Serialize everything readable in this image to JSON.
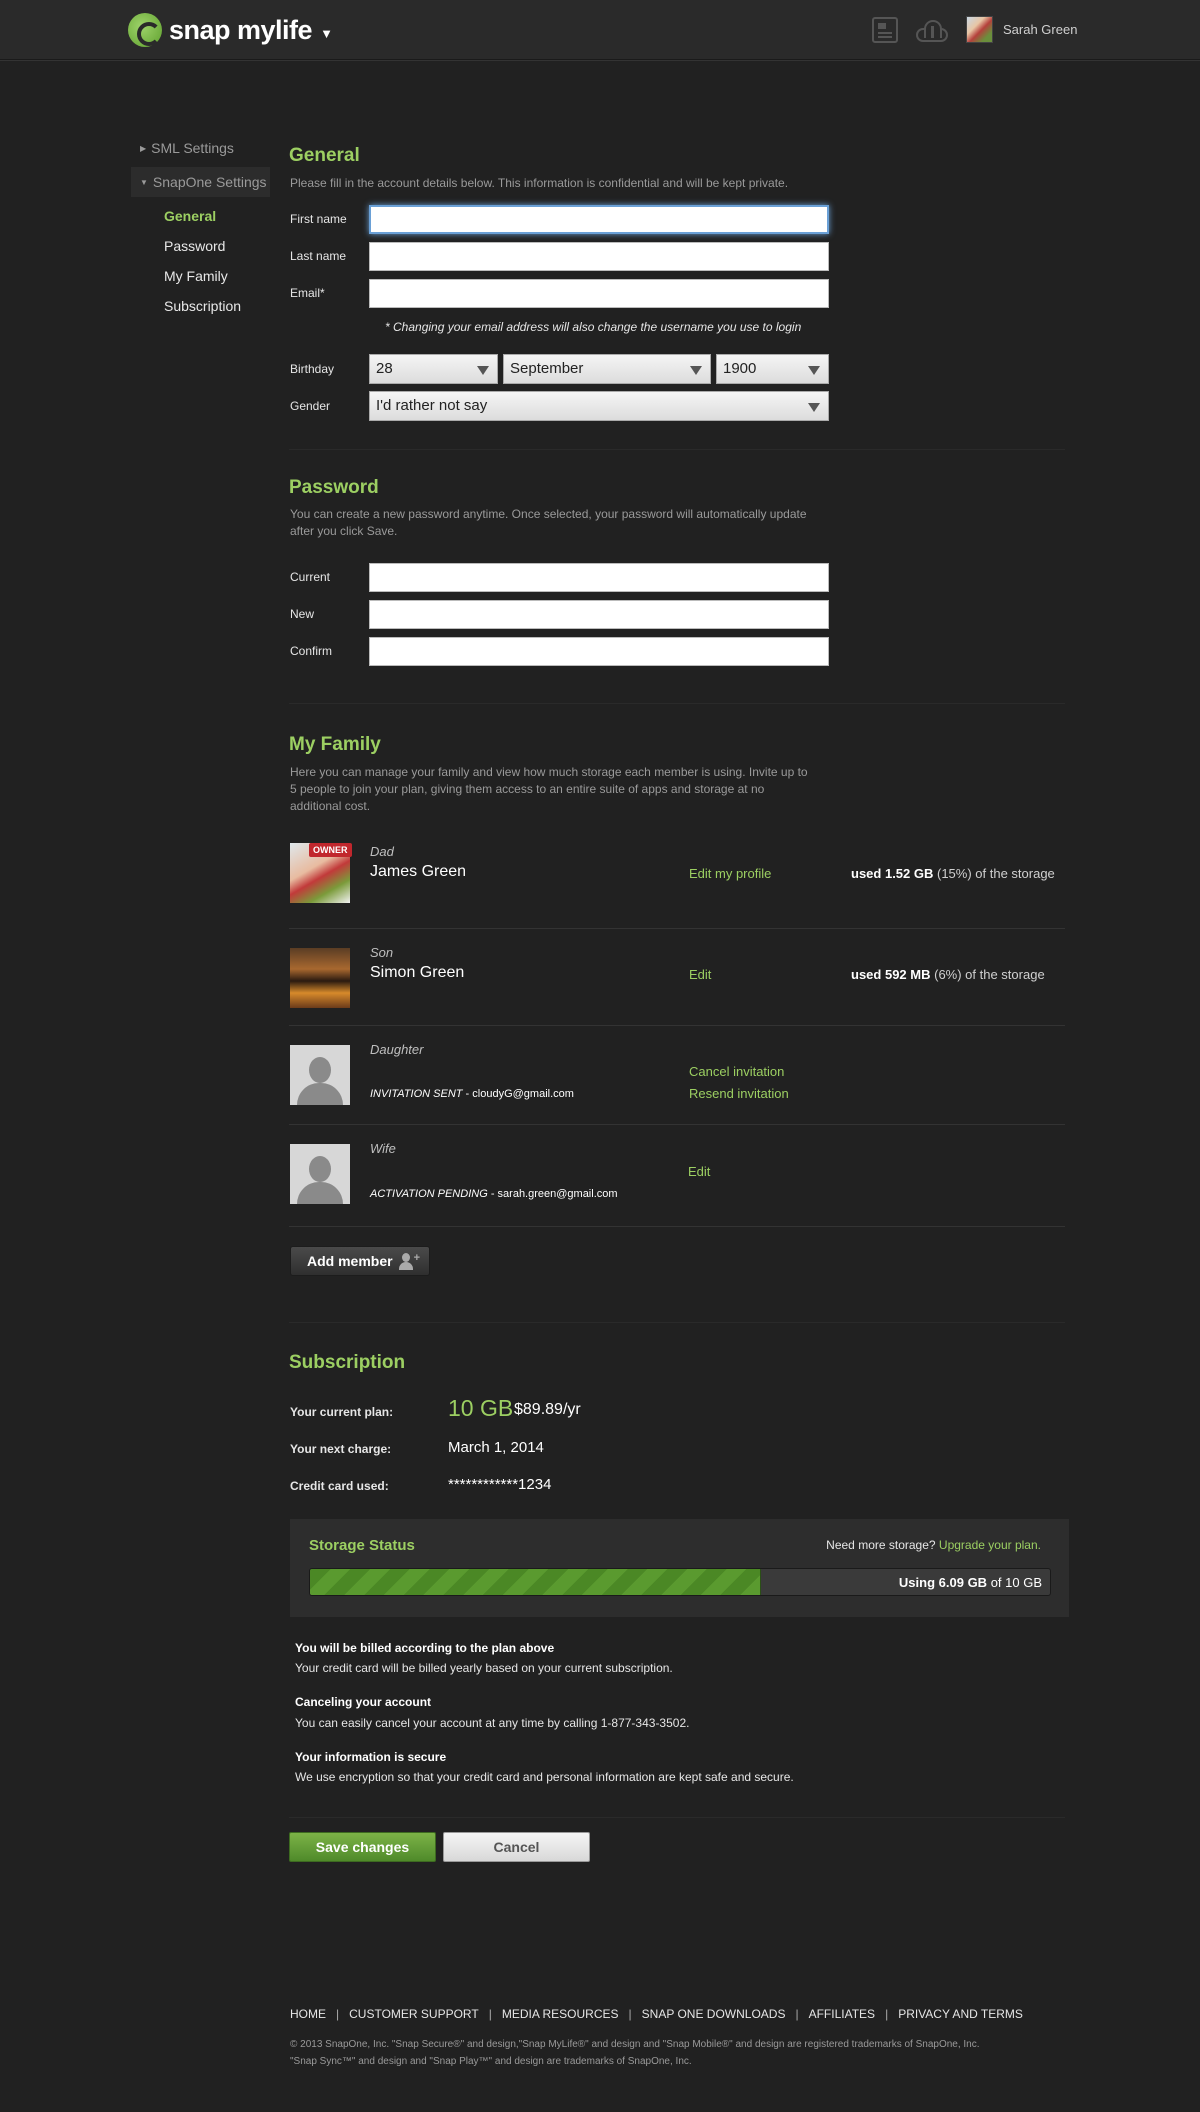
{
  "header": {
    "logo_text": "snap mylife",
    "user_name": "Sarah Green"
  },
  "sidebar": {
    "groups": [
      {
        "label": "SML Settings"
      },
      {
        "label": "SnapOne Settings"
      }
    ],
    "items": [
      {
        "label": "General"
      },
      {
        "label": "Password"
      },
      {
        "label": "My Family"
      },
      {
        "label": "Subscription"
      }
    ]
  },
  "general": {
    "title": "General",
    "description": "Please fill in the account details below. This information is confidential and will be kept private.",
    "first_name_label": "First name",
    "first_name_value": "",
    "last_name_label": "Last name",
    "last_name_value": "",
    "email_label": "Email*",
    "email_value": "",
    "email_note": "* Changing your email address will also change the username you use to login",
    "birthday_label": "Birthday",
    "birthday_day": "28",
    "birthday_month": "September",
    "birthday_year": "1900",
    "gender_label": "Gender",
    "gender_value": "I'd rather not say"
  },
  "password": {
    "title": "Password",
    "description_1": "You can create a new password anytime. Once selected, your password will automatically update",
    "description_2": "after you click Save.",
    "current_label": "Current",
    "new_label": "New",
    "confirm_label": "Confirm"
  },
  "family": {
    "title": "My Family",
    "description_1": "Here you can manage your family and view how much storage each member is using. Invite up to",
    "description_2": "5 people to join your plan, giving them access to an entire suite of apps and storage at no",
    "description_3": "additional cost.",
    "owner_badge": "OWNER",
    "members": [
      {
        "role": "Dad",
        "name": "James Green",
        "link": "Edit my profile",
        "usage_prefix": "used ",
        "usage_amount": "1.52 GB",
        "usage_suffix": " (15%) of the storage"
      },
      {
        "role": "Son",
        "name": "Simon Green",
        "link": "Edit",
        "usage_prefix": "used ",
        "usage_amount": "592 MB",
        "usage_suffix": " (6%) of the storage"
      },
      {
        "role": "Daughter",
        "status_label": "INVITATION SENT",
        "status_email": " - cloudyG@gmail.com",
        "link_1": "Cancel invitation",
        "link_2": "Resend invitation"
      },
      {
        "role": "Wife",
        "status_label": "ACTIVATION PENDING",
        "status_email": " - sarah.green@gmail.com",
        "link": "Edit"
      }
    ],
    "add_member_label": "Add member"
  },
  "subscription": {
    "title": "Subscription",
    "plan_label": "Your current plan:",
    "plan_size": "10 GB",
    "plan_price": "$89.89/yr",
    "next_charge_label": "Your next charge:",
    "next_charge_value": "March 1, 2014",
    "card_label": "Credit card used:",
    "card_value": "************1234",
    "storage": {
      "title": "Storage Status",
      "need_more": "Need more storage?",
      "upgrade_link": "Upgrade your plan.",
      "using_prefix": "Using ",
      "used": "6.09 GB",
      "of_total": " of 10 GB",
      "used_fraction": 0.609
    },
    "info": [
      {
        "heading": "You will be billed according to the plan above",
        "text": "Your credit card will be billed yearly based on your current subscription."
      },
      {
        "heading": "Canceling your account",
        "text": "You can easily cancel your account at any time by calling 1-877-343-3502."
      },
      {
        "heading": "Your information is secure",
        "text": "We use encryption so that your credit card and personal information are kept safe and secure."
      }
    ]
  },
  "actions": {
    "save_label": "Save changes",
    "cancel_label": "Cancel"
  },
  "footer": {
    "links": [
      "HOME",
      "CUSTOMER SUPPORT",
      "MEDIA RESOURCES",
      "SNAP ONE DOWNLOADS",
      "AFFILIATES",
      "PRIVACY AND TERMS"
    ],
    "separator": "|",
    "copyright_1": "© 2013 SnapOne, Inc. \"Snap Secure®\" and design,\"Snap MyLife®\" and design and \"Snap Mobile®\" and design are registered trademarks of SnapOne, Inc.",
    "copyright_2": "\"Snap Sync™\" and design and \"Snap Play™\" and design are trademarks of SnapOne, Inc."
  },
  "colors": {
    "accent": "#9ccf62",
    "background": "#212121",
    "owner_badge": "#c1272d",
    "save_button": "#6aa33a"
  },
  "icons": [
    "logo-mark-icon",
    "caret-down-icon",
    "news-icon",
    "cloud-upload-icon",
    "add-person-icon",
    "triangle-right-icon",
    "triangle-down-icon"
  ]
}
